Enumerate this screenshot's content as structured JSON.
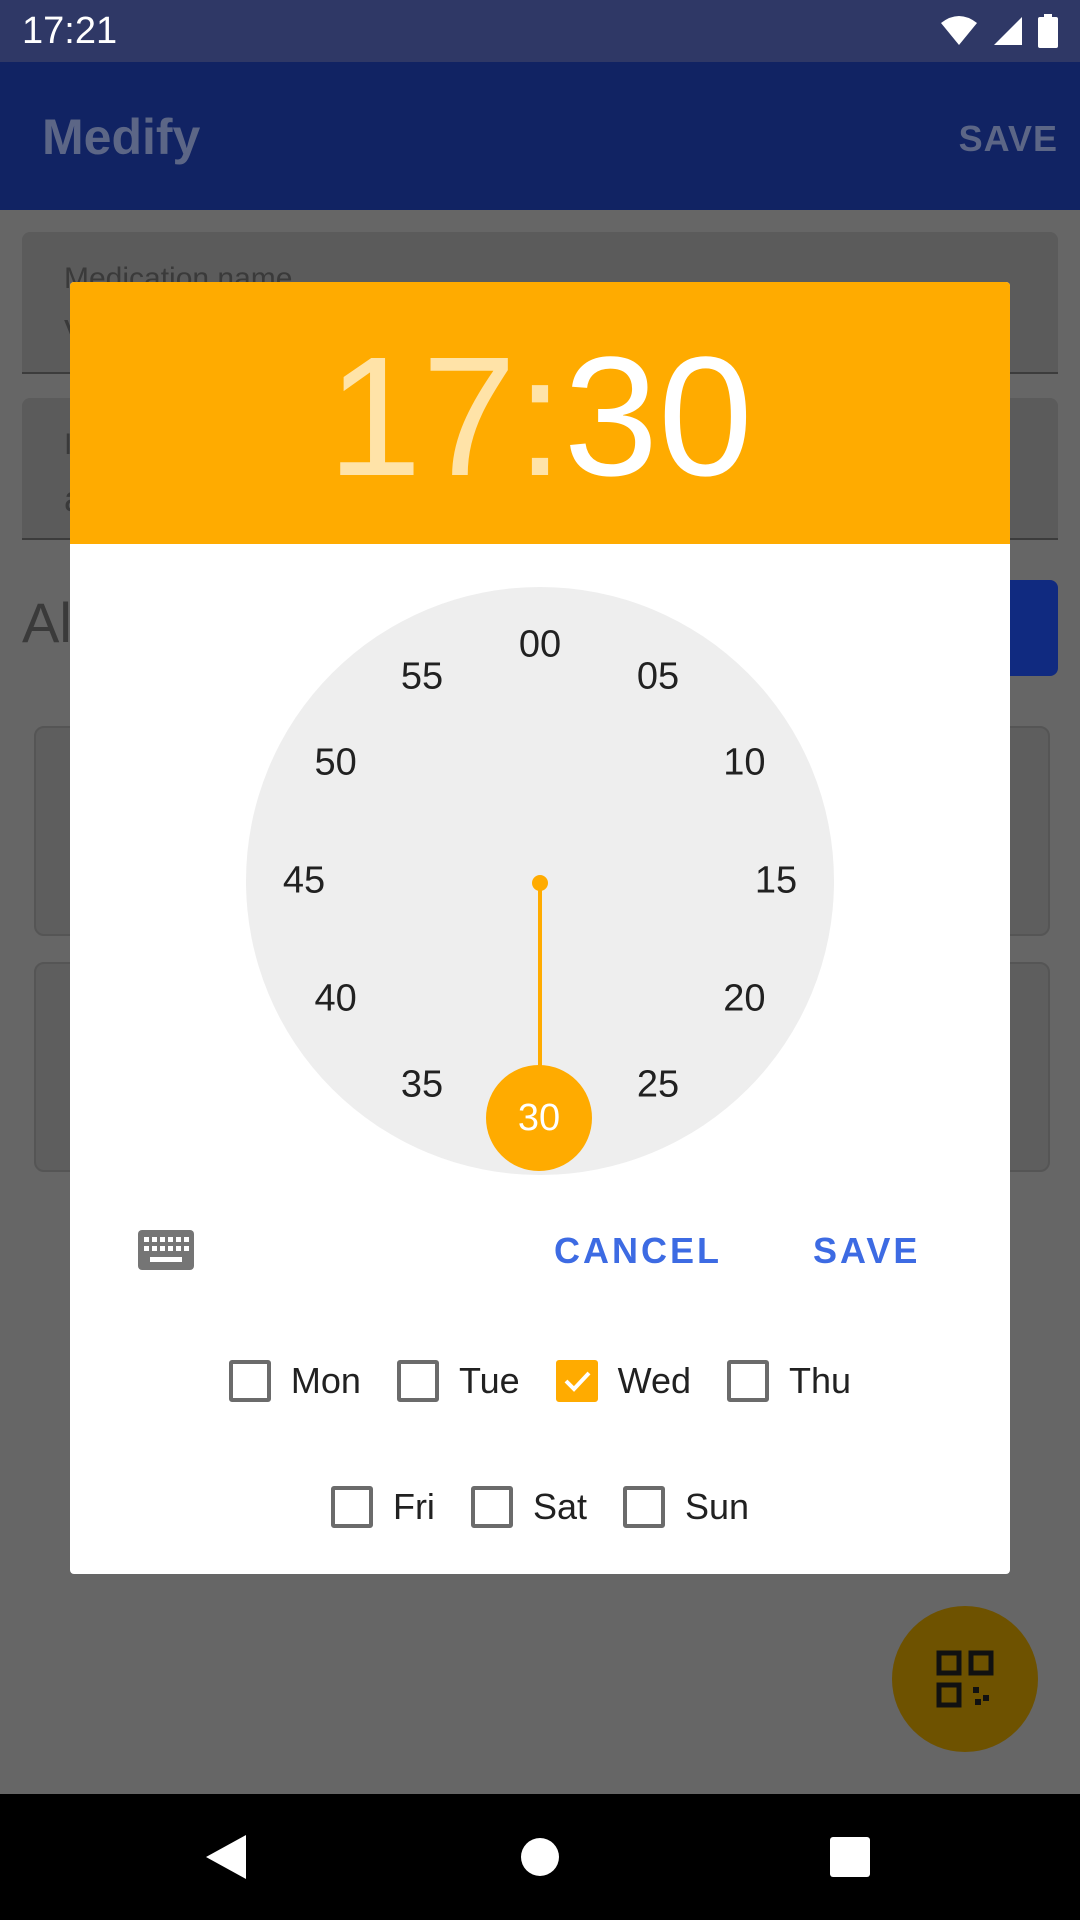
{
  "status_bar": {
    "time": "17:21"
  },
  "app_bar": {
    "title": "Medify",
    "save_label": "SAVE"
  },
  "background": {
    "field1_label": "Medication name",
    "field1_value": "V",
    "field2_label": "I",
    "field2_value": "a",
    "section_heading": "Al"
  },
  "time_picker": {
    "hour": "17",
    "separator": ":",
    "minute": "30",
    "selected_minute": "30",
    "minute_labels": [
      "00",
      "05",
      "10",
      "15",
      "20",
      "25",
      "30",
      "35",
      "40",
      "45",
      "50",
      "55"
    ],
    "cancel_label": "CANCEL",
    "save_label": "SAVE",
    "accent_color": "#ffab00",
    "button_color": "#3d6be3"
  },
  "days": [
    {
      "label": "Mon",
      "checked": false
    },
    {
      "label": "Tue",
      "checked": false
    },
    {
      "label": "Wed",
      "checked": true
    },
    {
      "label": "Thu",
      "checked": false
    },
    {
      "label": "Fri",
      "checked": false
    },
    {
      "label": "Sat",
      "checked": false
    },
    {
      "label": "Sun",
      "checked": false
    }
  ],
  "icons": {
    "keyboard": "keyboard-icon",
    "qr": "qr-code-icon",
    "wifi": "wifi-icon",
    "signal": "signal-icon",
    "battery": "battery-icon",
    "back": "back-icon",
    "home": "home-icon",
    "recents": "recents-icon"
  }
}
